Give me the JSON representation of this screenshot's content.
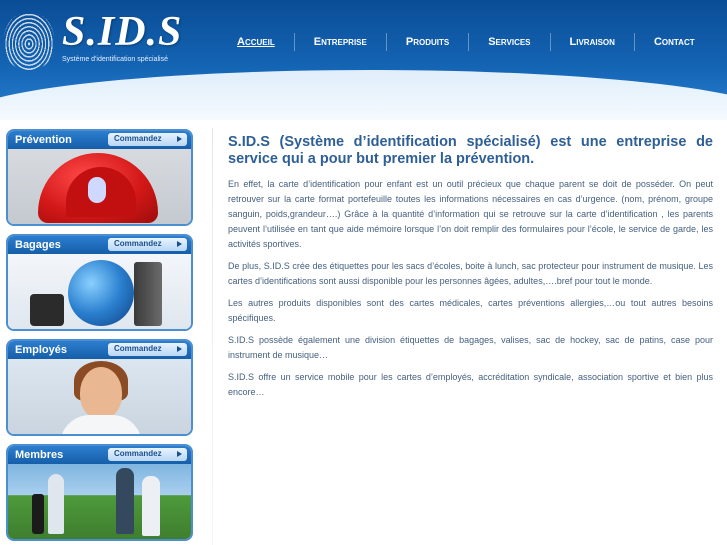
{
  "header": {
    "logo_text": "S.ID.S",
    "logo_subtitle": "Système d'identification spécialisé",
    "nav": [
      {
        "label": "Accueil",
        "active": true
      },
      {
        "label": "Entreprise",
        "active": false
      },
      {
        "label": "Produits",
        "active": false
      },
      {
        "label": "Services",
        "active": false
      },
      {
        "label": "Livraison",
        "active": false
      },
      {
        "label": "Contact",
        "active": false
      }
    ]
  },
  "sidebar": {
    "cards": [
      {
        "title": "Prévention",
        "button": "Commandez",
        "image": "playground-slide"
      },
      {
        "title": "Bagages",
        "button": "Commandez",
        "image": "globe-luggage"
      },
      {
        "title": "Employés",
        "button": "Commandez",
        "image": "smiling-employee"
      },
      {
        "title": "Membres",
        "button": "Commandez",
        "image": "golfers"
      }
    ]
  },
  "main": {
    "title": "S.ID.S (Système d’identification spécialisé) est une entreprise de service qui a pour but premier la prévention.",
    "paragraphs": [
      "En effet, la carte d’identification pour enfant est un outil précieux que chaque parent se doit de posséder. On peut retrouver sur la carte format portefeuille toutes les informations nécessaires en cas d’urgence. (nom, prénom, groupe sanguin, poids,grandeur….) Grâce à la quantité d’information qui se retrouve sur la carte d’identification , les parents peuvent l’utilisée en tant que aide mémoire lorsque l’on doit remplir des formulaires pour l’école, le service de garde, les activités sportives.",
      "De plus, S.ID.S crée des étiquettes pour les sacs d’écoles, boite à lunch, sac protecteur pour instrument de musique. Les cartes d’identifications sont aussi disponible pour les personnes âgées, adultes,….bref pour tout le monde.",
      "Les autres produits disponibles sont des cartes médicales, cartes préventions allergies,…ou tout autres besoins spécifiques.",
      "S.ID.S possède également une division étiquettes de bagages, valises, sac de hockey, sac de patins, case pour instrument de musique…",
      "S.ID.S offre un service mobile pour les cartes d’employés, accréditation syndicale, association sportive et bien plus encore…"
    ]
  },
  "colors": {
    "header_blue": "#1464b4",
    "title_blue": "#2e5f96",
    "text_gray_blue": "#45607f",
    "card_border": "#4c8fd1"
  }
}
